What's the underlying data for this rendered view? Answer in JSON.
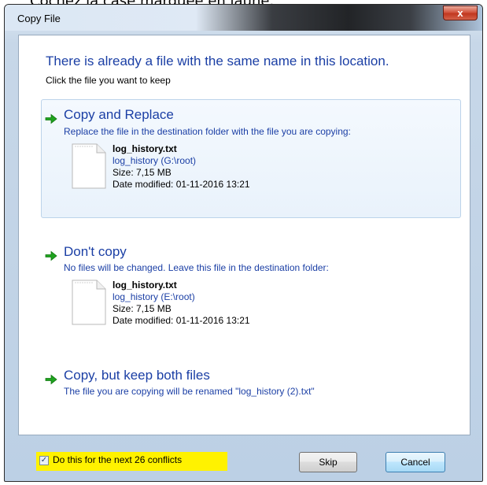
{
  "caption": "Cochez la case marquée en jaune.",
  "window": {
    "title": "Copy File",
    "close_label": "x"
  },
  "header": {
    "heading": "There is already a file with the same name in this location.",
    "subheading": "Click the file you want to keep"
  },
  "options": [
    {
      "title": "Copy and Replace",
      "description": "Replace the file in the destination folder with the file you are copying:",
      "file": {
        "name": "log_history.txt",
        "path": "log_history (G:\\root)",
        "size": "Size: 7,15 MB",
        "modified": "Date modified: 01-11-2016 13:21"
      }
    },
    {
      "title": "Don't copy",
      "description": "No files will be changed. Leave this file in the destination folder:",
      "file": {
        "name": "log_history.txt",
        "path": "log_history (E:\\root)",
        "size": "Size: 7,15 MB",
        "modified": "Date modified: 01-11-2016 13:21"
      }
    },
    {
      "title": "Copy, but keep both files",
      "description": "The file you are copying will be renamed \"log_history (2).txt\""
    }
  ],
  "footer": {
    "checkbox_label": "Do this for the next 26 conflicts",
    "checkbox_checked": true,
    "checkbox_mark": "✓",
    "highlight_color": "#fff200",
    "skip_label": "Skip",
    "cancel_label": "Cancel"
  },
  "icons": {
    "arrow": "green-arrow-icon",
    "file": "text-file-icon"
  },
  "colors": {
    "link_blue": "#1b3fa5",
    "arrow_green": "#1fa31f"
  }
}
